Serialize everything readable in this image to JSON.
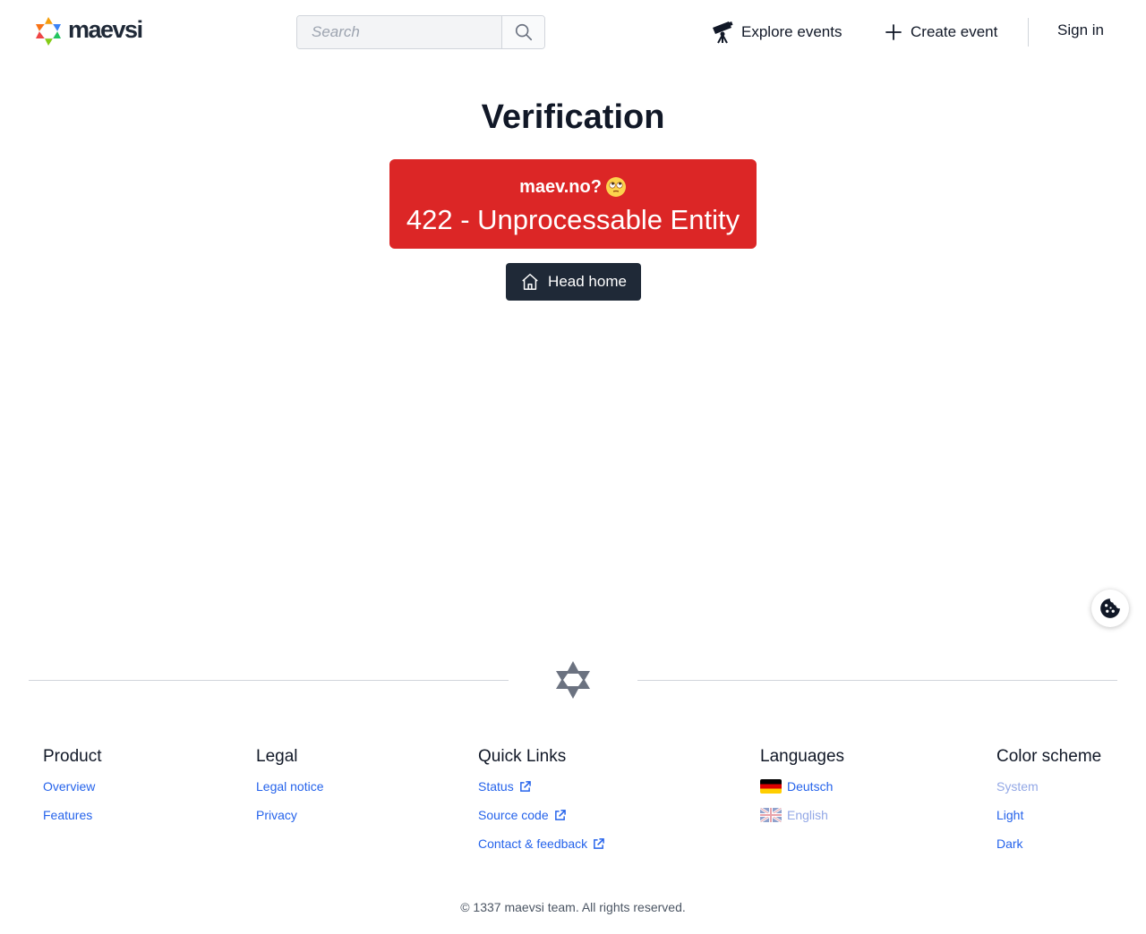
{
  "brand": {
    "name": "maevsi"
  },
  "search": {
    "placeholder": "Search"
  },
  "nav": {
    "explore": "Explore events",
    "create": "Create event",
    "signin": "Sign in"
  },
  "page": {
    "title": "Verification",
    "error_heading": "maev.no?",
    "error_message": "422 - Unprocessable Entity",
    "home_button": "Head home"
  },
  "footer": {
    "product": {
      "heading": "Product",
      "links": [
        "Overview",
        "Features"
      ]
    },
    "legal": {
      "heading": "Legal",
      "links": [
        "Legal notice",
        "Privacy"
      ]
    },
    "quick_links": {
      "heading": "Quick Links",
      "links": [
        "Status",
        "Source code",
        "Contact & feedback"
      ]
    },
    "languages": {
      "heading": "Languages",
      "links": [
        "Deutsch",
        "English"
      ],
      "selected": "English"
    },
    "color_scheme": {
      "heading": "Color scheme",
      "links": [
        "System",
        "Light",
        "Dark"
      ],
      "selected": "System"
    },
    "copyright": "© 1337 maevsi team. All rights reserved."
  },
  "icons": [
    "telescope-icon",
    "plus-icon",
    "search-icon",
    "home-icon",
    "cookie-icon",
    "external-link-icon",
    "rolling-eyes-emoji"
  ],
  "colors": {
    "error": "#dc2626",
    "dark_button": "#1f2937",
    "link": "#2563eb"
  }
}
